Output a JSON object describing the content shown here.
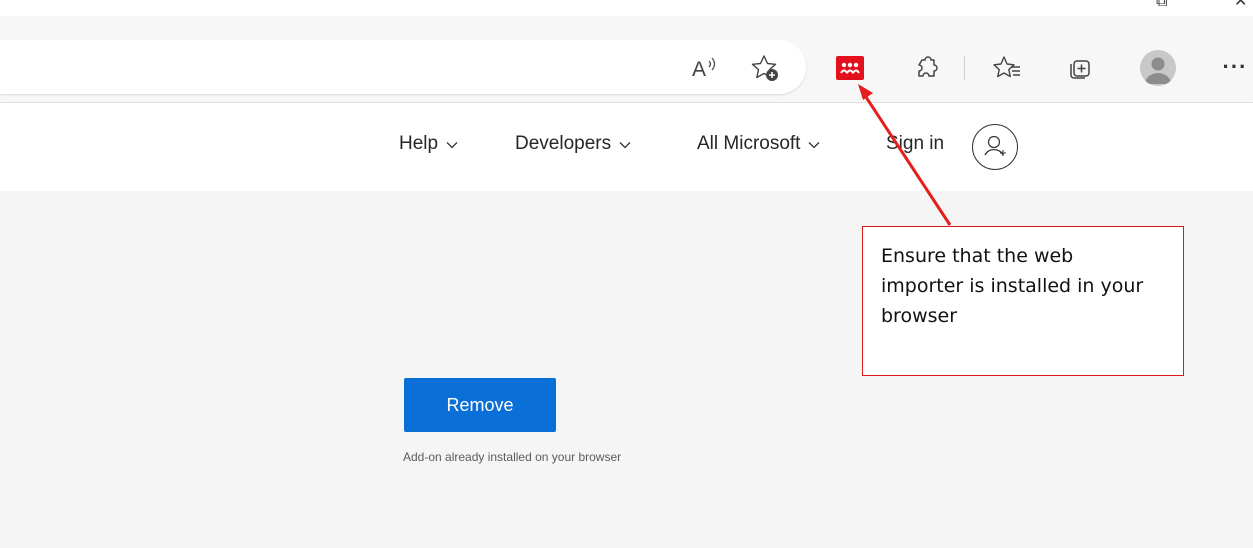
{
  "window": {
    "restore_glyph": "⧉",
    "close_glyph": "✕"
  },
  "toolbar": {
    "icons": [
      "read-aloud-icon",
      "add-favorite-icon",
      "mendeley-extension-icon",
      "extensions-icon",
      "favorites-icon",
      "collections-icon",
      "profile-avatar-icon",
      "more-icon"
    ],
    "read_aloud_glyph": "A",
    "more_glyph": "···",
    "extension_color": "#e3101d"
  },
  "site_nav": {
    "help": "Help",
    "developers": "Developers",
    "all_microsoft": "All Microsoft",
    "sign_in": "Sign in"
  },
  "content": {
    "remove_label": "Remove",
    "installed_note": "Add-on already installed on your browser",
    "button_color": "#0a6fd6"
  },
  "callout": {
    "text": "Ensure that the web importer is installed in your browser",
    "border_color": "#d81b1b"
  }
}
